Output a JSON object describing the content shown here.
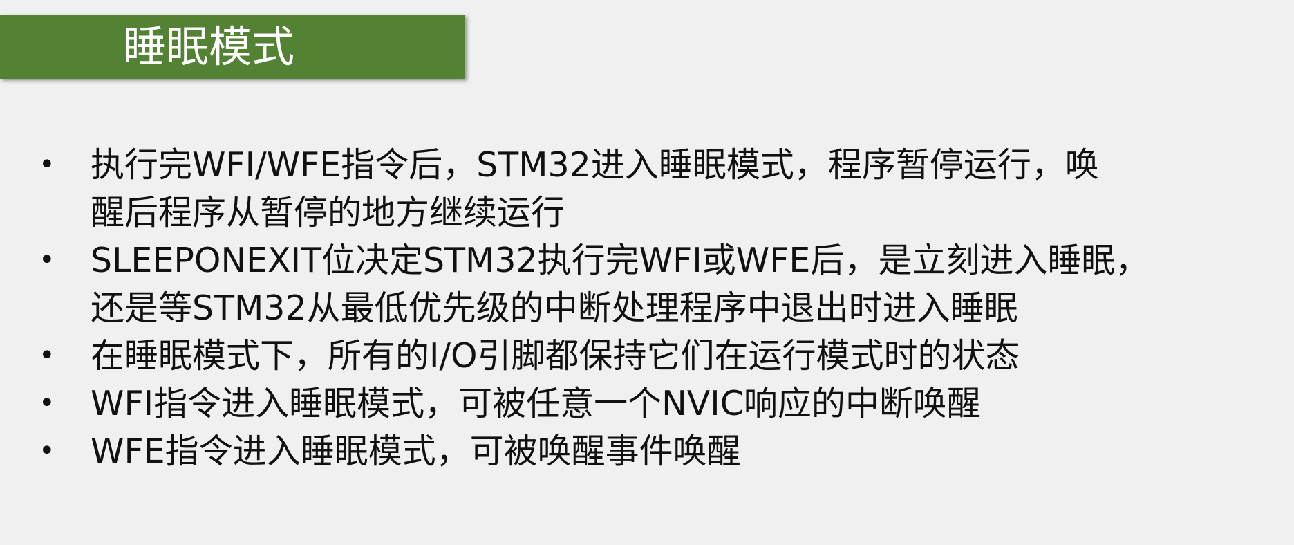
{
  "slide": {
    "title": "睡眠模式",
    "accent_color": "#548235",
    "background_color": "#f0f0f0",
    "bullet_glyph": "•",
    "bullets": [
      "执行完WFI/WFE指令后，STM32进入睡眠模式，程序暂停运行，唤\n醒后程序从暂停的地方继续运行",
      "SLEEPONEXIT位决定STM32执行完WFI或WFE后，是立刻进入睡眠，\n还是等STM32从最低优先级的中断处理程序中退出时进入睡眠",
      "在睡眠模式下，所有的I/O引脚都保持它们在运行模式时的状态",
      "WFI指令进入睡眠模式，可被任意一个NVIC响应的中断唤醒",
      "WFE指令进入睡眠模式，可被唤醒事件唤醒"
    ]
  }
}
